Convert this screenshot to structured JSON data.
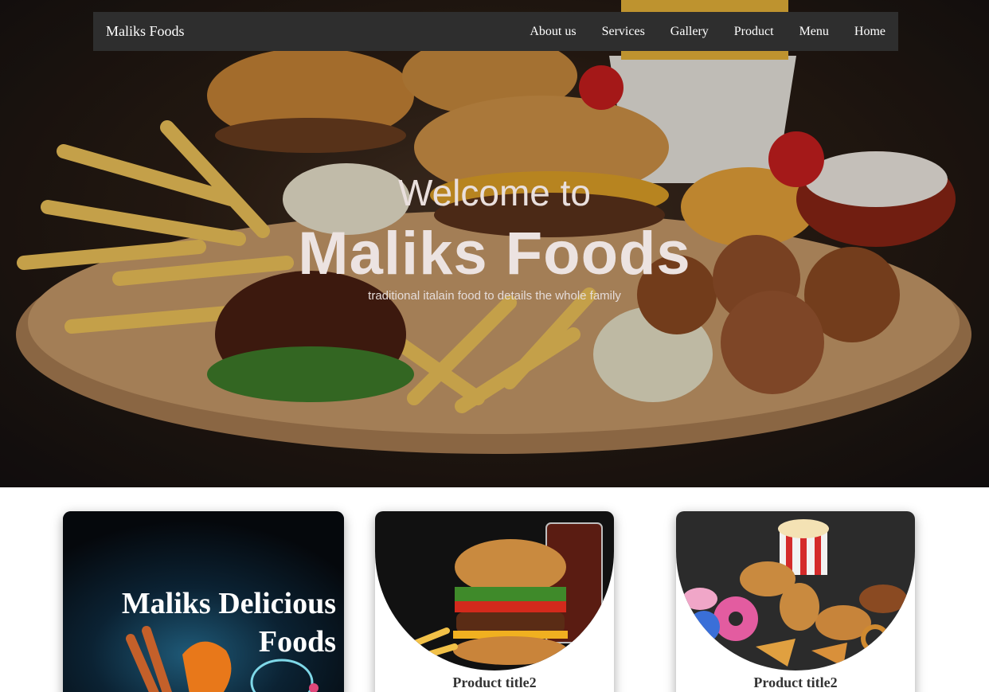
{
  "nav": {
    "brand": "Maliks Foods",
    "links": [
      "About us",
      "Services",
      "Gallery",
      "Product",
      "Menu",
      "Home"
    ]
  },
  "hero": {
    "welcome": "Welcome to",
    "title": "Maliks Foods",
    "tagline": "traditional italain food to details the whole family"
  },
  "cards": {
    "feature_title": "Maliks Delicious Foods",
    "products": [
      {
        "title": "Product title2"
      },
      {
        "title": "Product title2"
      }
    ]
  },
  "colors": {
    "navbar_bg": "#2e2e2e",
    "hero_text": "#ece3e1",
    "caption": "#333333"
  }
}
